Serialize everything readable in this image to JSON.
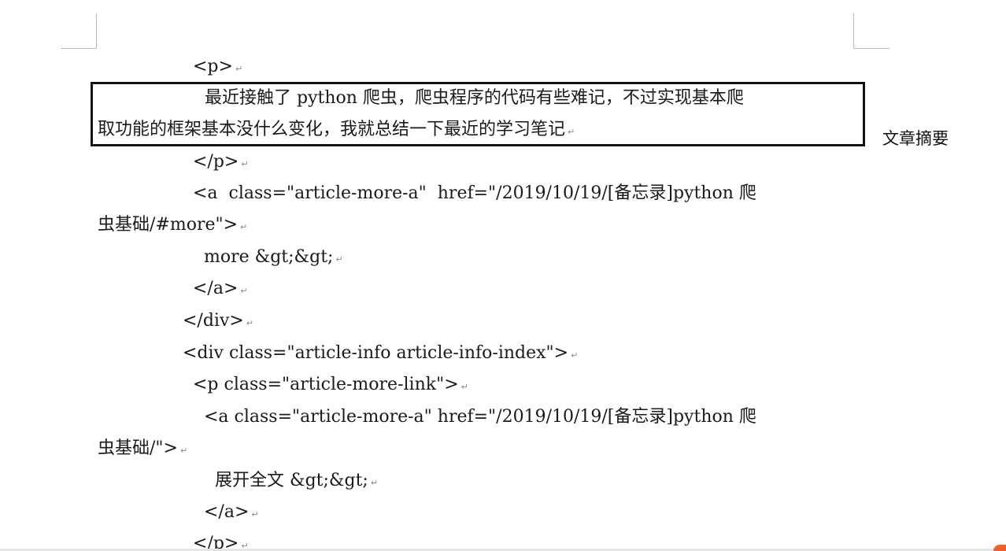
{
  "document": {
    "return_mark": "↵",
    "lines": [
      {
        "text": "<p>"
      },
      {
        "text": "最近接触了 python 爬虫，爬虫程序的代码有些难记，不过实现基本爬"
      },
      {
        "text": "取功能的框架基本没什么变化，我就总结一下最近的学习笔记"
      },
      {
        "text": "</p>"
      },
      {
        "text": "<a  class=\"article-more-a\"  href=\"/2019/10/19/[备忘录]python 爬"
      },
      {
        "text": "虫基础/#more\">"
      },
      {
        "text": "more &gt;&gt;"
      },
      {
        "text": "</a>"
      },
      {
        "text": "</div>"
      },
      {
        "text": "<div class=\"article-info article-info-index\">"
      },
      {
        "text": "<p class=\"article-more-link\">"
      },
      {
        "text": "<a class=\"article-more-a\" href=\"/2019/10/19/[备忘录]python 爬"
      },
      {
        "text": "虫基础/\">"
      },
      {
        "text": "展开全文 &gt;&gt;"
      },
      {
        "text": "</a>"
      },
      {
        "text": "</p>"
      }
    ]
  },
  "annotation": {
    "label": "文章摘要"
  }
}
